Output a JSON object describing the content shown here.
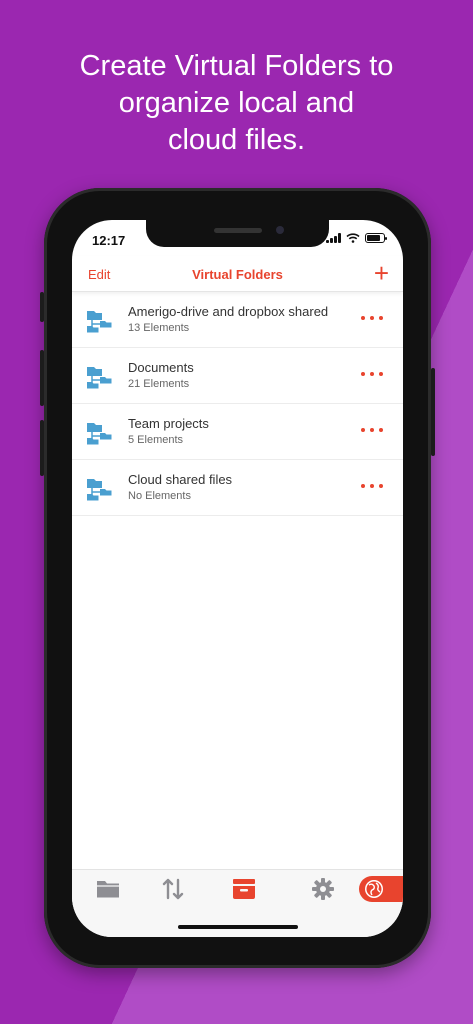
{
  "headline": {
    "line1": "Create Virtual Folders to",
    "line2": "organize local and",
    "line3": "cloud files."
  },
  "status_bar": {
    "time": "12:17"
  },
  "navbar": {
    "edit_label": "Edit",
    "title": "Virtual Folders",
    "add_label": "+"
  },
  "folders": [
    {
      "name": "Amerigo-drive and dropbox shared",
      "count": "13 Elements"
    },
    {
      "name": "Documents",
      "count": "21 Elements"
    },
    {
      "name": "Team projects",
      "count": "5 Elements"
    },
    {
      "name": "Cloud shared files",
      "count": "No Elements"
    }
  ],
  "tabs": [
    {
      "icon": "folder-icon"
    },
    {
      "icon": "transfer-icon"
    },
    {
      "icon": "archive-box-icon"
    },
    {
      "icon": "gear-icon"
    },
    {
      "icon": "globe-icon"
    }
  ],
  "colors": {
    "accent": "#e8442e",
    "background": "#9b27b0",
    "folder_icon": "#4a9fd0"
  }
}
